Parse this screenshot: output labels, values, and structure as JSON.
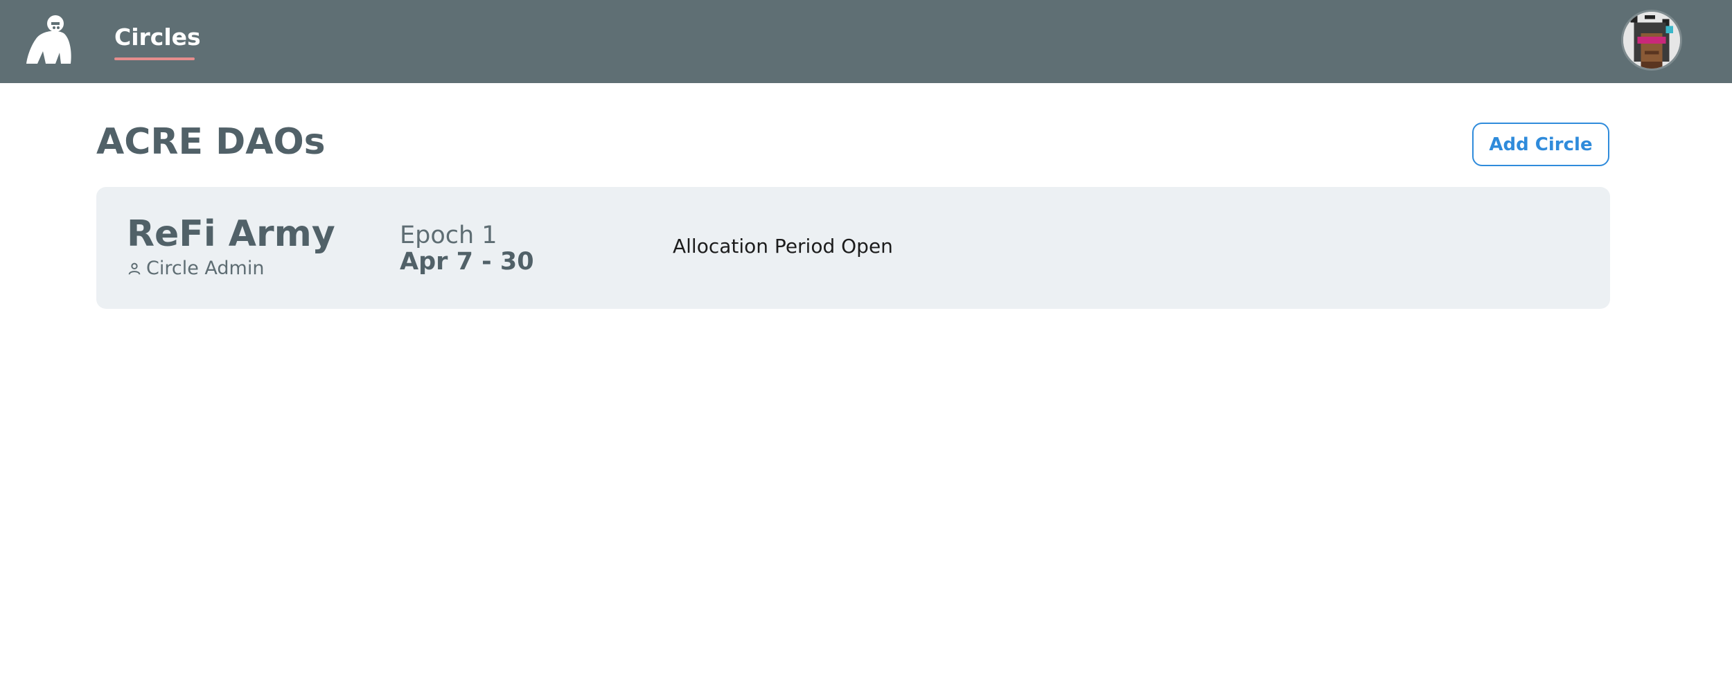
{
  "header": {
    "nav_label": "Circles",
    "logo_icon": "gorilla-logo-icon",
    "avatar_icon": "pixel-avatar-icon",
    "bg_color": "#5f6f74",
    "nav_underline_color": "#e58d8d"
  },
  "main": {
    "title": "ACRE DAOs",
    "add_button_label": "Add Circle",
    "accent_color": "#2f8bdb"
  },
  "circles": [
    {
      "name": "ReFi Army",
      "role": "Circle Admin",
      "role_icon": "user-icon",
      "epoch_label": "Epoch 1",
      "epoch_dates": "Apr 7 - 30",
      "status": "Allocation Period Open"
    }
  ]
}
